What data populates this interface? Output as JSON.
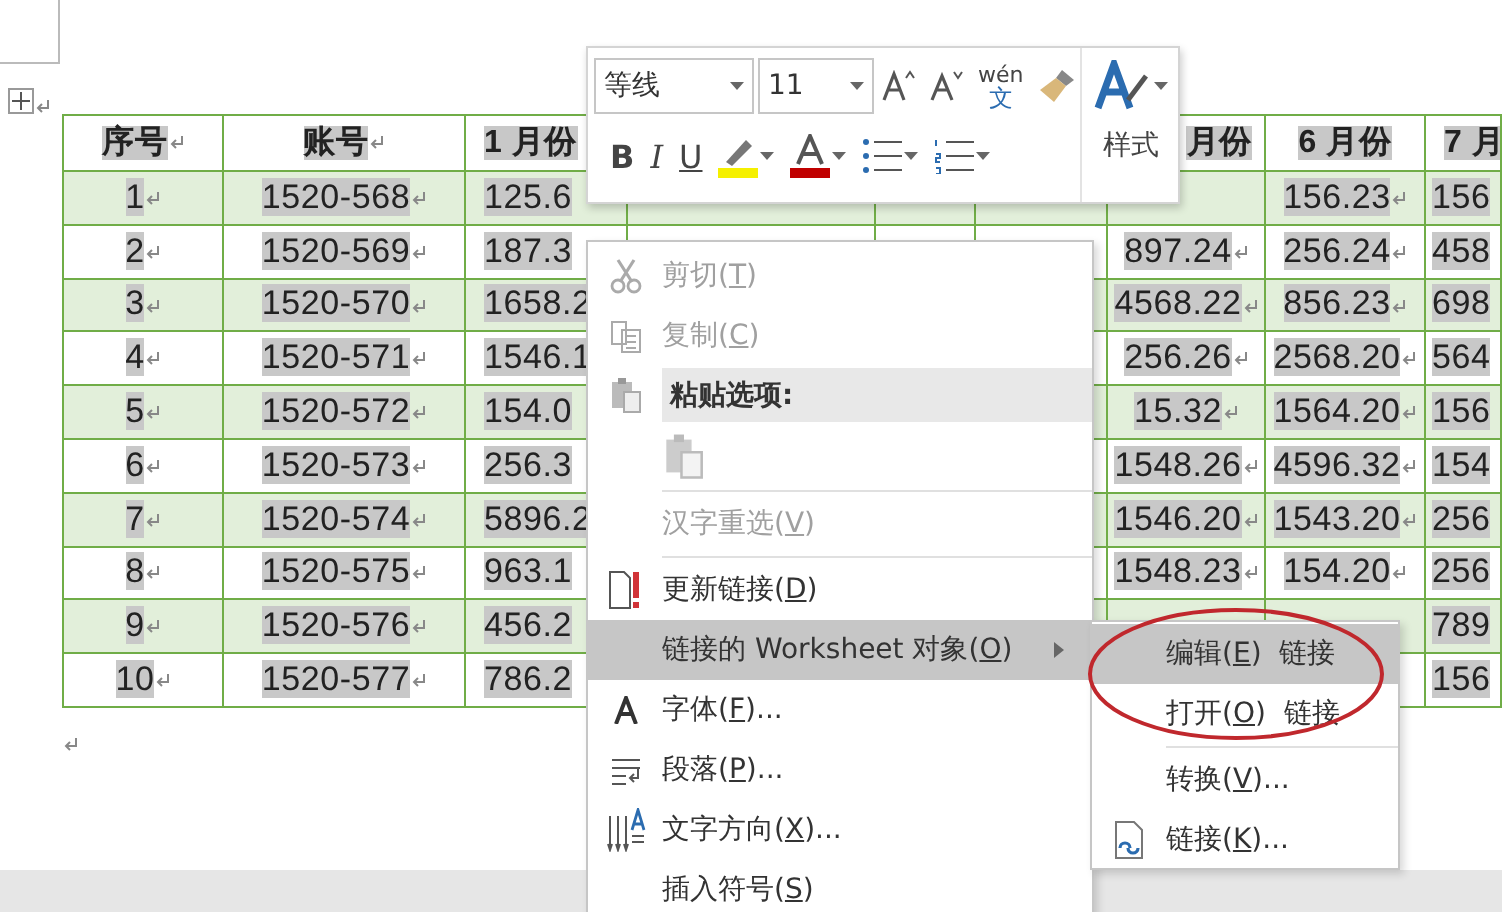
{
  "table": {
    "columns": [
      "序号",
      "账号",
      "1 月份",
      "月份",
      "6 月份",
      "7 月"
    ],
    "rows": [
      {
        "cells": [
          "1",
          "1520-568",
          "125.6",
          null,
          "156.23",
          "156"
        ]
      },
      {
        "cells": [
          "2",
          "1520-569",
          "187.3",
          "897.24",
          "256.24",
          "458"
        ]
      },
      {
        "cells": [
          "3",
          "1520-570",
          "1658.2",
          "4568.22",
          "856.23",
          "698"
        ]
      },
      {
        "cells": [
          "4",
          "1520-571",
          "1546.1",
          "256.26",
          "2568.20",
          "564"
        ]
      },
      {
        "cells": [
          "5",
          "1520-572",
          "154.0",
          "15.32",
          "1564.20",
          "156"
        ]
      },
      {
        "cells": [
          "6",
          "1520-573",
          "256.3",
          "1548.26",
          "4596.32",
          "154"
        ]
      },
      {
        "cells": [
          "7",
          "1520-574",
          "5896.2",
          "1546.20",
          "1543.20",
          "256"
        ]
      },
      {
        "cells": [
          "8",
          "1520-575",
          "963.1",
          "1548.23",
          "154.20",
          "256"
        ]
      },
      {
        "cells": [
          "9",
          "1520-576",
          "456.2",
          null,
          null,
          "789"
        ]
      },
      {
        "cells": [
          "10",
          "1520-577",
          "786.2",
          null,
          null,
          "156"
        ]
      }
    ]
  },
  "mini_toolbar": {
    "font_name": "等线",
    "font_size": "11",
    "phonetic_top": "wén",
    "phonetic_bottom": "文",
    "bold": "B",
    "italic": "I",
    "underline": "U",
    "styles_label": "样式"
  },
  "context_menu": {
    "items": [
      {
        "kind": "command",
        "label": "剪切(",
        "key": "T",
        "tail": ")",
        "disabled": true,
        "selected": false
      },
      {
        "kind": "command",
        "label": "复制(",
        "key": "C",
        "tail": ")",
        "disabled": true,
        "selected": false
      },
      {
        "kind": "header",
        "label": "粘贴选项:"
      },
      {
        "kind": "paste"
      },
      {
        "kind": "separator"
      },
      {
        "kind": "command",
        "label": "汉字重选(",
        "key": "V",
        "tail": ")",
        "disabled": true,
        "selected": false
      },
      {
        "kind": "separator"
      },
      {
        "kind": "command",
        "label": "更新链接(",
        "key": "D",
        "tail": ")",
        "disabled": false,
        "selected": false
      },
      {
        "kind": "command",
        "label": "链接的 Worksheet 对象(",
        "key": "O",
        "tail": ")",
        "disabled": false,
        "selected": true,
        "submenu": true
      },
      {
        "kind": "command",
        "label": "字体(",
        "key": "F",
        "tail": ")...",
        "disabled": false,
        "selected": false
      },
      {
        "kind": "command",
        "label": "段落(",
        "key": "P",
        "tail": ")...",
        "disabled": false,
        "selected": false
      },
      {
        "kind": "command",
        "label": "文字方向(",
        "key": "X",
        "tail": ")...",
        "disabled": false,
        "selected": false
      },
      {
        "kind": "command",
        "label": "插入符号(",
        "key": "S",
        "tail": ")",
        "disabled": false,
        "selected": false
      }
    ]
  },
  "submenu": {
    "items": [
      {
        "kind": "command",
        "label": "编辑(",
        "key": "E",
        "tail": ")  链接",
        "selected": true
      },
      {
        "kind": "command",
        "label": "打开(",
        "key": "O",
        "tail": ")  链接",
        "selected": false
      },
      {
        "kind": "separator"
      },
      {
        "kind": "command",
        "label": "转换(",
        "key": "V",
        "tail": ")...",
        "selected": false
      },
      {
        "kind": "command",
        "label": "链接(",
        "key": "K",
        "tail": ")...",
        "selected": false
      }
    ]
  }
}
